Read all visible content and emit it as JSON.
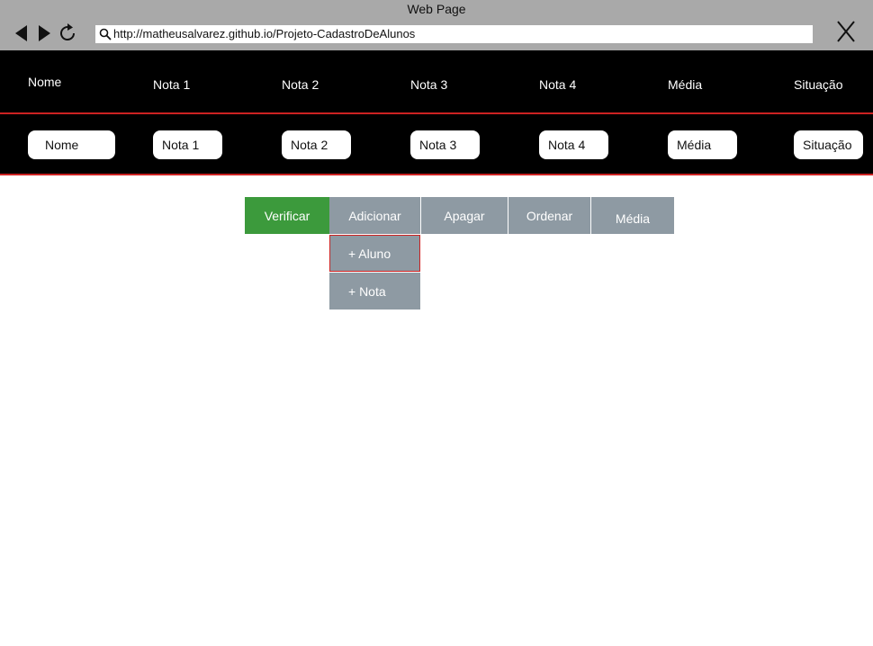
{
  "window": {
    "title": "Web Page",
    "url": "http://matheusalvarez.github.io/Projeto-CadastroDeAlunos"
  },
  "icons": {
    "back": "back-arrow-icon",
    "forward": "forward-arrow-icon",
    "reload": "reload-icon",
    "search": "search-icon",
    "close": "close-icon"
  },
  "columns": [
    "Nome",
    "Nota 1",
    "Nota 2",
    "Nota 3",
    "Nota 4",
    "Média",
    "Situação"
  ],
  "fields": {
    "nome": "Nome",
    "nota1": "Nota 1",
    "nota2": "Nota 2",
    "nota3": "Nota 3",
    "nota4": "Nota 4",
    "media": "Média",
    "situacao": "Situação"
  },
  "menu": {
    "verificar": "Verificar",
    "adicionar": "Adicionar",
    "apagar": "Apagar",
    "ordenar": "Ordenar",
    "media": "Média",
    "submenu": [
      "+ Aluno",
      "+ Nota"
    ]
  },
  "colors": {
    "header_bg": "#000000",
    "accent_red": "#cc2222",
    "button_green": "#3c9a3c",
    "button_gray": "#8e9aa3",
    "chrome_gray": "#a9a9a9"
  }
}
